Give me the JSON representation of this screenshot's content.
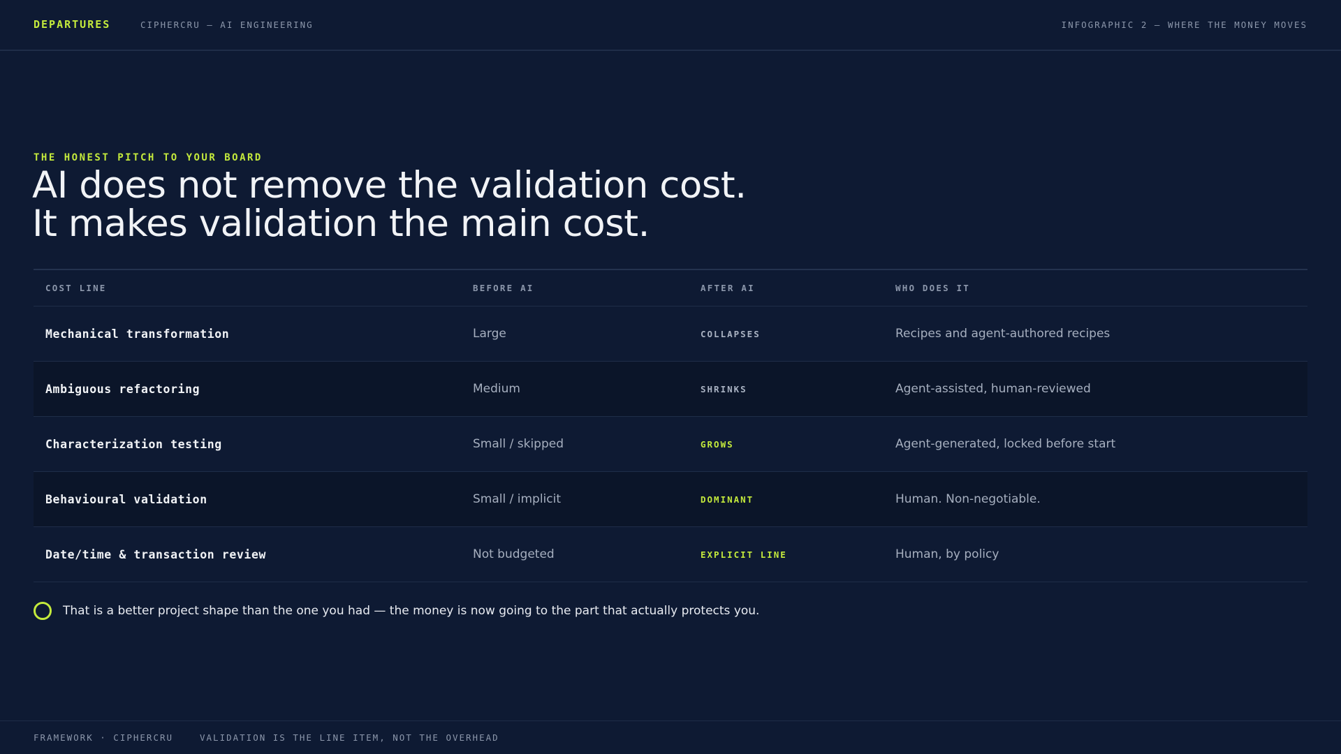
{
  "header": {
    "brand": "DEPARTURES",
    "crumb": "CIPHERCRU — AI ENGINEERING",
    "right": "INFOGRAPHIC 2 — WHERE THE MONEY MOVES"
  },
  "hero": {
    "eyebrow": "THE HONEST PITCH TO YOUR BOARD",
    "line1": "AI does not remove the validation cost.",
    "line2": "It makes validation the main cost."
  },
  "table": {
    "headers": [
      "COST LINE",
      "BEFORE AI",
      "AFTER AI",
      "WHO DOES IT"
    ],
    "rows": [
      {
        "name": "Mechanical transformation",
        "before": "Large",
        "after": "COLLAPSES",
        "who": "Recipes and agent-authored recipes"
      },
      {
        "name": "Ambiguous refactoring",
        "before": "Medium",
        "after": "SHRINKS",
        "who": "Agent-assisted, human-reviewed"
      },
      {
        "name": "Characterization testing",
        "before": "Small / skipped",
        "after": "GROWS",
        "who": "Agent-generated, locked before start"
      },
      {
        "name": "Behavioural validation",
        "before": "Small / implicit",
        "after": "DOMINANT",
        "who": "Human. Non-negotiable."
      },
      {
        "name": "Date/time & transaction review",
        "before": "Not budgeted",
        "after": "EXPLICIT LINE",
        "who": "Human, by policy"
      }
    ]
  },
  "callout": {
    "icon": "circle-outline-icon",
    "text": "That is a better project shape than the one you had — the money is now going to the part that actually protects you."
  },
  "footer": {
    "left": "FRAMEWORK · CIPHERCRU",
    "middle": "VALIDATION IS THE LINE ITEM, NOT THE OVERHEAD"
  },
  "colors": {
    "background": "#0e1a33",
    "accent": "#c4ea3c",
    "muted_tag": "#8c97ab"
  }
}
